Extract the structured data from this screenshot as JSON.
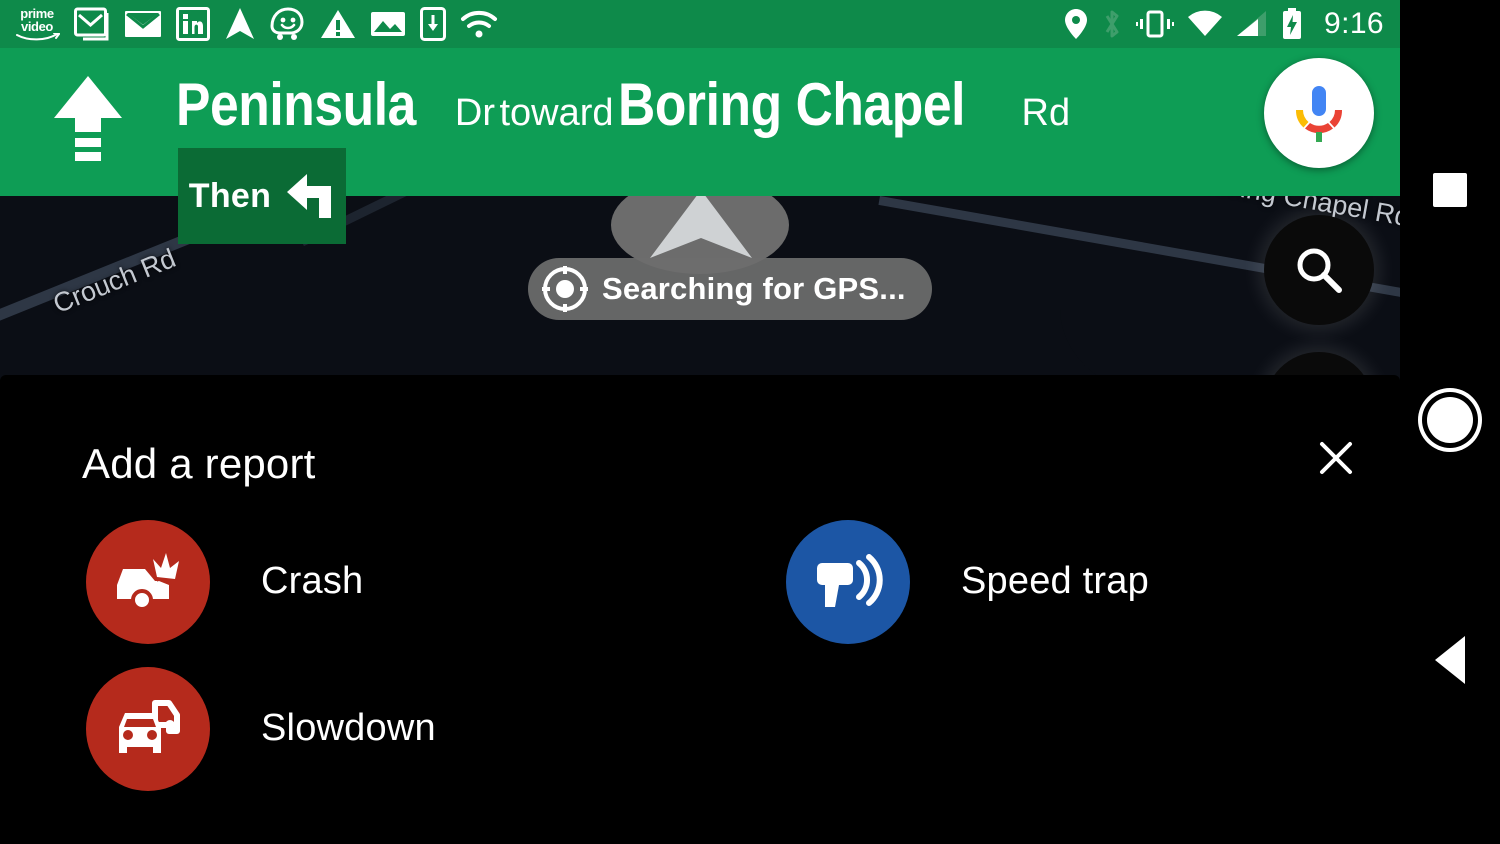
{
  "status_bar": {
    "time": "9:16",
    "left_icons": [
      {
        "name": "prime-video-icon",
        "label_top": "prime",
        "label_bottom": "video"
      },
      {
        "name": "gmail-icon"
      },
      {
        "name": "email-icon"
      },
      {
        "name": "linkedin-icon",
        "glyph": "in"
      },
      {
        "name": "navigation-arrow-icon"
      },
      {
        "name": "waze-icon"
      },
      {
        "name": "warning-triangle-icon"
      },
      {
        "name": "photo-icon"
      },
      {
        "name": "download-to-phone-icon"
      },
      {
        "name": "wifi-icon"
      }
    ],
    "right_icons": [
      {
        "name": "location-pin-icon"
      },
      {
        "name": "bluetooth-icon"
      },
      {
        "name": "vibrate-icon"
      },
      {
        "name": "wifi-icon"
      },
      {
        "name": "cell-signal-icon"
      },
      {
        "name": "battery-charging-icon"
      }
    ],
    "background_color": "#0E8A4A"
  },
  "nav_banner": {
    "background_color": "#0E9D55",
    "maneuver": "continue-straight",
    "street_main": "Peninsula",
    "street_suffix": "Dr",
    "connector": "toward",
    "destination_main": "Boring Chapel",
    "destination_suffix": "Rd",
    "then": {
      "label": "Then",
      "maneuver": "turn-left",
      "background_color": "#0B6B35"
    }
  },
  "map": {
    "gps_status": "Searching for GPS...",
    "labels": [
      {
        "name": "map-label-crouch-rd",
        "text": "Crouch Rd"
      },
      {
        "name": "map-label-boring-chapel-rd",
        "text": "Boring Chapel Rd"
      }
    ],
    "route_color": "#4285F4",
    "background_color": "#1B2230"
  },
  "fabs": [
    {
      "name": "assistant-mic-fab",
      "icon": "microphone-icon"
    },
    {
      "name": "search-fab",
      "icon": "search-icon"
    }
  ],
  "report_panel": {
    "title": "Add a report",
    "close_label": "✕",
    "background_color": "#000000",
    "items": [
      {
        "id": "crash",
        "label": "Crash",
        "icon": "car-crash-icon",
        "color": "#B52A1C"
      },
      {
        "id": "speed-trap",
        "label": "Speed trap",
        "icon": "speed-camera-icon",
        "color": "#1C56A5"
      },
      {
        "id": "slowdown",
        "label": "Slowdown",
        "icon": "traffic-slowdown-icon",
        "color": "#B52A1C"
      }
    ]
  },
  "android_navbar": {
    "buttons": [
      {
        "name": "recents-button",
        "shape": "square"
      },
      {
        "name": "home-button",
        "shape": "circle"
      },
      {
        "name": "back-button",
        "shape": "triangle"
      }
    ]
  }
}
